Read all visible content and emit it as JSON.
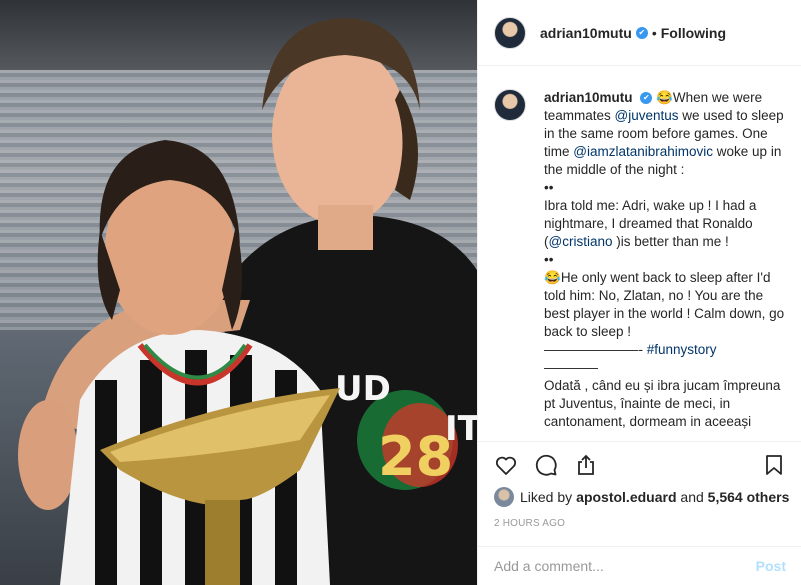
{
  "header": {
    "username": "adrian10mutu",
    "verified_mark": "✔",
    "separator": "•",
    "follow_status": "Following"
  },
  "caption": {
    "username": "adrian10mutu",
    "verified_mark": "✔",
    "line1_emoji": "😂",
    "line1_text": "When we were teammates ",
    "mention_juventus": "@juventus",
    "line1_rest": " we used to sleep in the same room before games. One time ",
    "mention_zlatan": "@iamzlatanibrahimovic",
    "line1_end": " woke up in the middle of the night :",
    "sep1": "••",
    "line2_text": "Ibra told me: Adri, wake up ! I had a nightmare, I dreamed that Ronaldo (",
    "mention_cristiano": "@cristiano",
    "line2_end": " )is better than me !",
    "sep2": "••",
    "line3_emoji": "😂",
    "line3_text": "He only went back to sleep after I'd told him: No, Zlatan, no ! You are the best player in the world ! Calm down, go back to sleep !",
    "line4_dashes": "———————- ",
    "hashtag": "#funnystory",
    "line5_dashes": "————",
    "line6_text": "Odată , când eu și ibra jucam împreuna pt Juventus, înainte de meci, in cantonament, dormeam in aceeași"
  },
  "actions": {
    "like_icon": "heart-icon",
    "comment_icon": "comment-icon",
    "share_icon": "share-icon",
    "save_icon": "bookmark-icon"
  },
  "likes": {
    "prefix": "Liked by ",
    "user": "apostol.eduard",
    "middle": " and ",
    "count": "5,564 others"
  },
  "timestamp": "2 HOURS AGO",
  "comment": {
    "placeholder": "Add a comment...",
    "post_label": "Post"
  },
  "colors": {
    "link": "#003569",
    "verified": "#3897f0",
    "post_disabled": "#b2dffc"
  }
}
